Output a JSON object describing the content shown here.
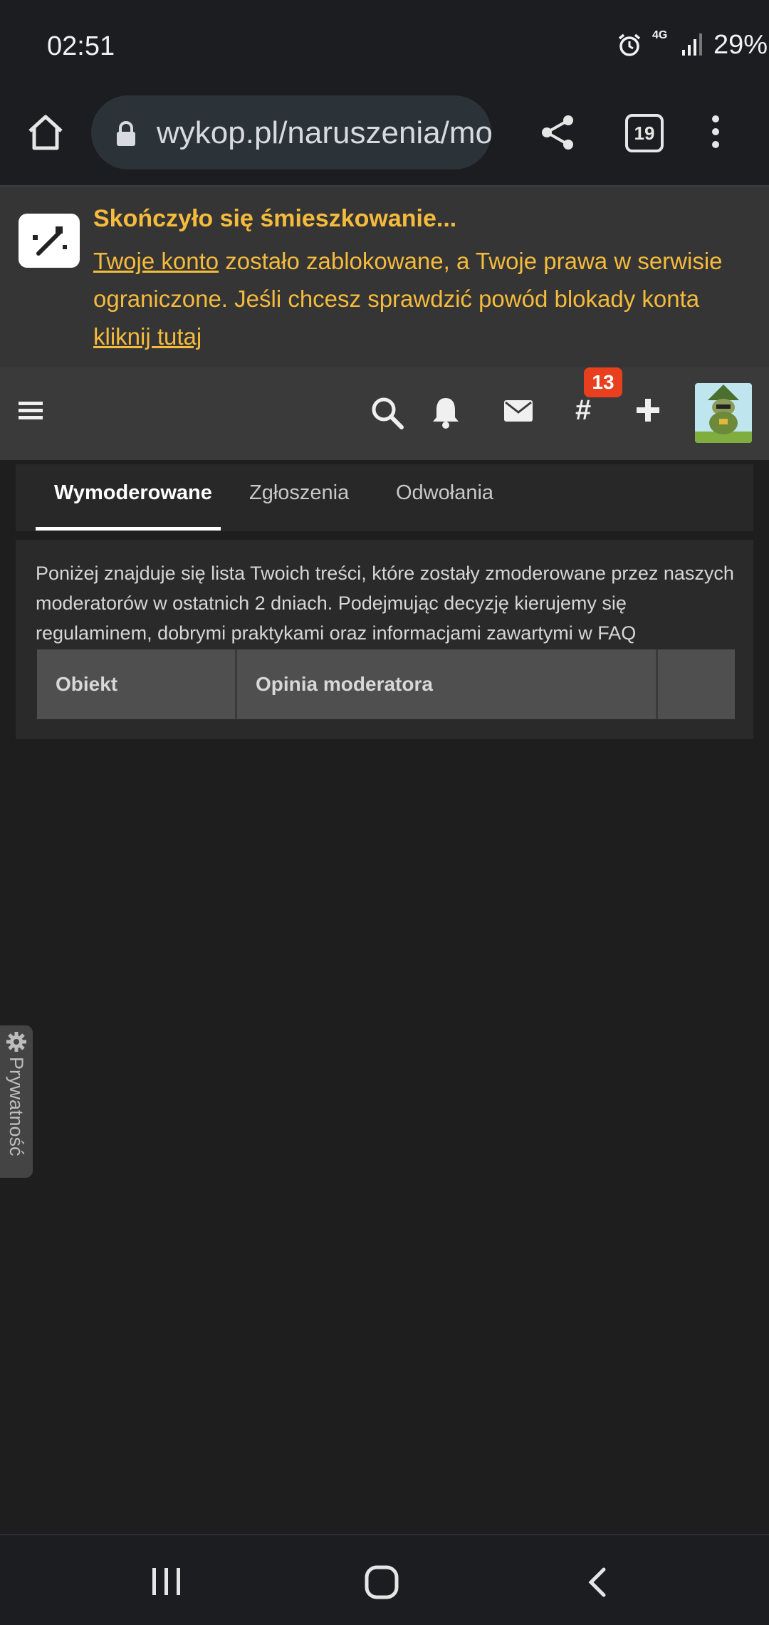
{
  "status_bar": {
    "time": "02:51",
    "network": "4G",
    "battery": "29%",
    "icons": [
      "alarm-icon",
      "signal-icon",
      "battery-icon"
    ]
  },
  "browser": {
    "url": "wykop.pl/naruszenia/moderated",
    "tab_count": "19",
    "icons": [
      "home-icon",
      "lock-icon",
      "share-icon",
      "tabs-icon",
      "more-icon"
    ]
  },
  "notice": {
    "title": "Skończyło się śmieszkowanie...",
    "link_account": "Twoje konto",
    "text_1": " zostało zablokowane, a Twoje prawa w serwisie ograniczone. Jeśli chcesz sprawdzić powód blokady konta ",
    "link_here": "kliknij tutaj",
    "accent_color": "#f5bb3c"
  },
  "site_nav": {
    "tags_badge": "13",
    "icons": [
      "hamburger-icon",
      "search-icon",
      "bell-icon",
      "mail-icon",
      "hashtag-icon",
      "plus-icon",
      "avatar"
    ]
  },
  "tabs": [
    {
      "label": "Wymoderowane",
      "active": true
    },
    {
      "label": "Zgłoszenia",
      "active": false
    },
    {
      "label": "Odwołania",
      "active": false
    }
  ],
  "content": {
    "description": "Poniżej znajduje się lista Twoich treści, które zostały zmoderowane przez naszych moderatorów w ostatnich 2 dniach. Podejmując decyzję kierujemy się regulaminem, dobrymi praktykami oraz informacjami zawartymi w FAQ",
    "table_headers": [
      "Obiekt",
      "Opinia moderatora",
      ""
    ]
  },
  "privacy": {
    "label": "Prywatność"
  },
  "nav_bar": {
    "icons": [
      "recents-icon",
      "home-circle-icon",
      "back-icon"
    ]
  }
}
